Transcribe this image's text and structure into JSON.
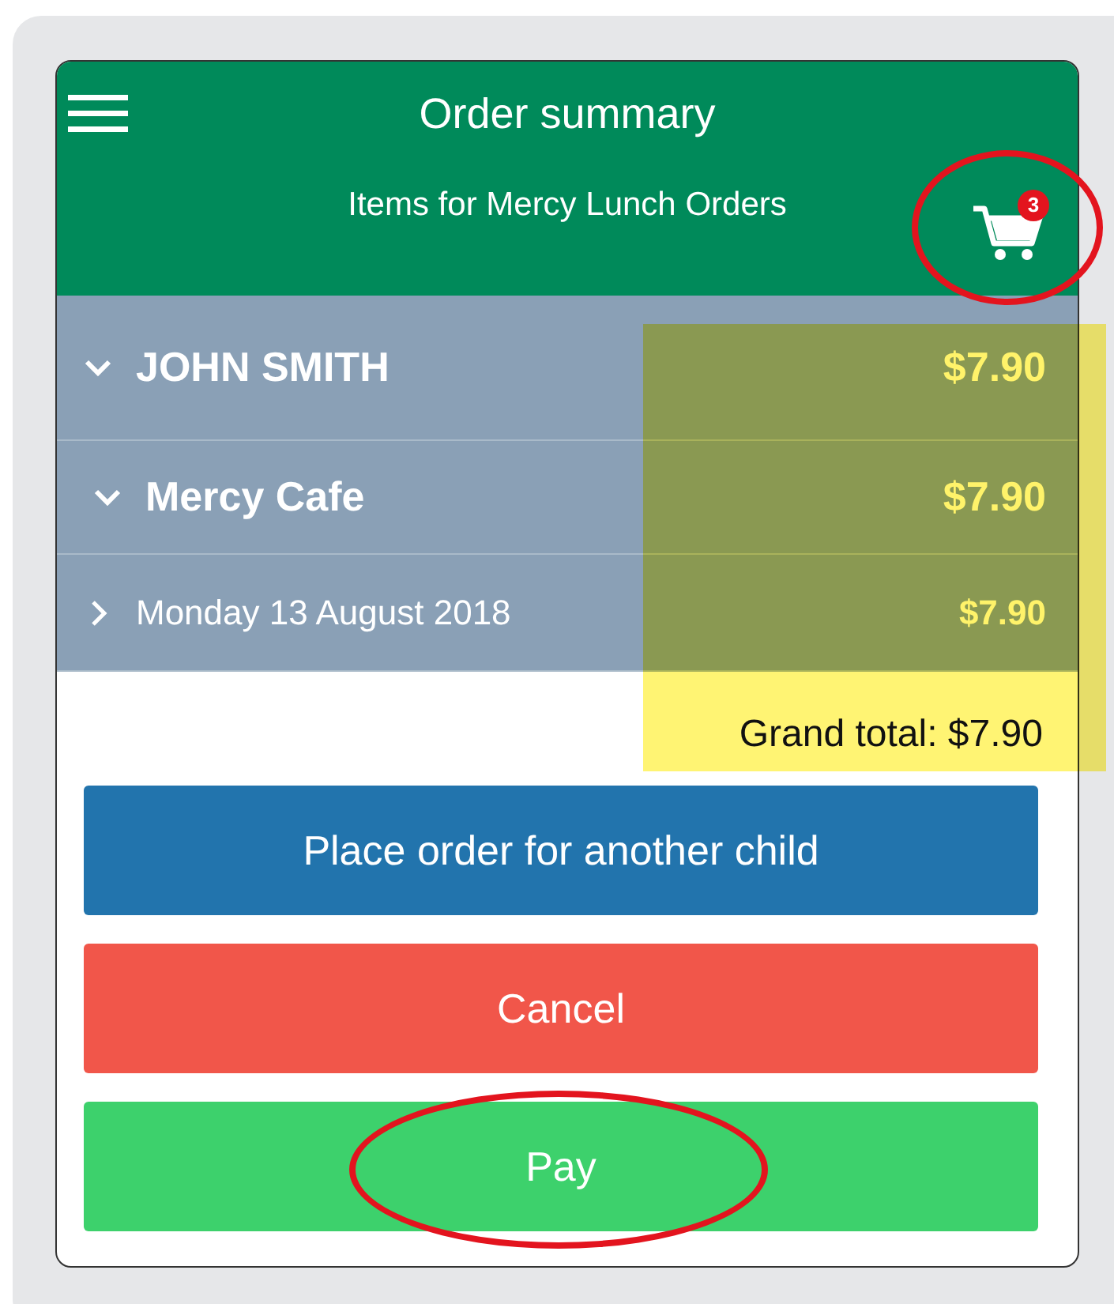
{
  "header": {
    "title": "Order summary",
    "subtitle": "Items for Mercy Lunch Orders",
    "cart_count": "3"
  },
  "order": [
    {
      "label": "JOHN SMITH",
      "amount": "$7.90",
      "expanded": true,
      "children": [
        {
          "label": "Mercy Cafe",
          "amount": "$7.90",
          "expanded": true,
          "children": [
            {
              "label": "Monday 13 August 2018",
              "amount": "$7.90",
              "expanded": false
            }
          ]
        }
      ]
    }
  ],
  "grand_total": "Grand total: $7.90",
  "buttons": [
    {
      "label": "Place order for another child",
      "kind": "primary"
    },
    {
      "label": "Cancel",
      "kind": "danger"
    },
    {
      "label": "Pay",
      "kind": "success"
    }
  ]
}
